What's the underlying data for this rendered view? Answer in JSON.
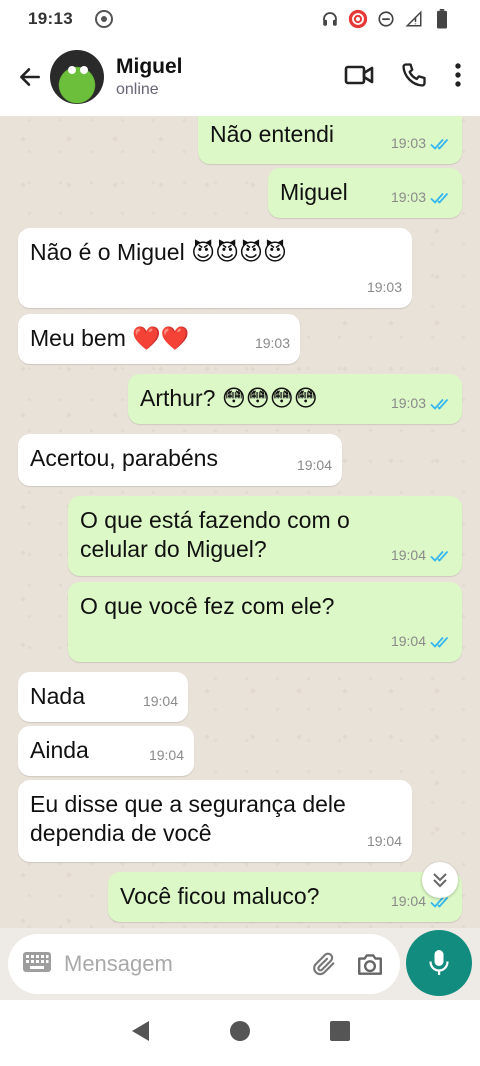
{
  "status_bar": {
    "time": "19:13"
  },
  "header": {
    "contact_name": "Miguel",
    "contact_status": "online"
  },
  "messages": [
    {
      "dir": "out",
      "text": "Não entendi",
      "time": "19:03"
    },
    {
      "dir": "out",
      "text": "Miguel",
      "time": "19:03"
    },
    {
      "dir": "in",
      "text": "Não é o Miguel 😈😈😈😈",
      "time": "19:03"
    },
    {
      "dir": "in",
      "text": "Meu bem ❤️❤️",
      "time": "19:03"
    },
    {
      "dir": "out",
      "text": "Arthur? 😳😳😳😳",
      "time": "19:03"
    },
    {
      "dir": "in",
      "text": "Acertou, parabéns",
      "time": "19:04"
    },
    {
      "dir": "out",
      "text": "O que está fazendo com o\ncelular do Miguel?",
      "time": "19:04"
    },
    {
      "dir": "out",
      "text": "O que você fez com ele?",
      "time": "19:04"
    },
    {
      "dir": "in",
      "text": "Nada",
      "time": "19:04"
    },
    {
      "dir": "in",
      "text": "Ainda",
      "time": "19:04"
    },
    {
      "dir": "in",
      "text": "Eu disse que a segurança dele\ndependia de você",
      "time": "19:04"
    },
    {
      "dir": "out",
      "text": "Você ficou maluco?",
      "time": "19:04"
    }
  ],
  "composer": {
    "placeholder": "Mensagem"
  },
  "colors": {
    "outgoing_bubble": "#dcf8c6",
    "incoming_bubble": "#ffffff",
    "read_ticks": "#34b7f1",
    "mic_button": "#128c7e"
  }
}
